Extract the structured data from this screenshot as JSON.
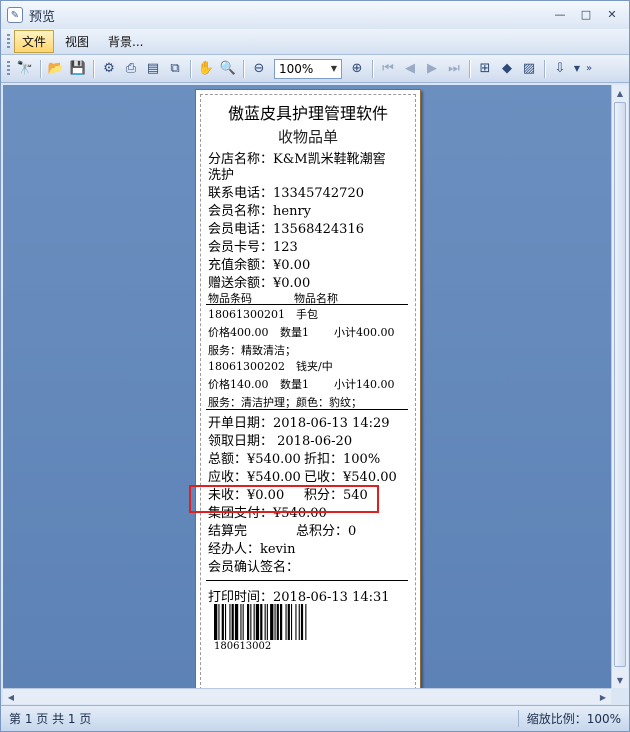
{
  "window": {
    "title": "预览",
    "controls": [
      "—",
      "□",
      "✕"
    ]
  },
  "menu": {
    "items": [
      "文件",
      "视图",
      "背景..."
    ]
  },
  "toolbar": {
    "zoom_value": "100%"
  },
  "status": {
    "pages": "第 1 页 共 1 页",
    "zoom": "缩放比例：100%"
  },
  "receipt": {
    "title": "傲蓝皮具护理管理软件",
    "subtitle": "收物品单",
    "store_line1": "分店名称：K&M凯米鞋靴潮窖",
    "store_line2": "洗护",
    "phone": "联系电话：13345742720",
    "member_name": "会员名称：henry",
    "member_phone": "会员电话：13568424316",
    "card_no": "会员卡号：123",
    "recharge_balance": "充值余额：¥0.00",
    "gift_balance": "赠送余额：¥0.00",
    "col_code": "物品条码",
    "col_name": "物品名称",
    "items": [
      {
        "code": "18061300201",
        "name": "手包",
        "price": "价格400.00",
        "qty": "数量1",
        "subtotal": "小计400.00",
        "service": "服务：精致清洁；"
      },
      {
        "code": "18061300202",
        "name": "钱夹/中",
        "price": "价格140.00",
        "qty": "数量1",
        "subtotal": "小计140.00",
        "service": "服务：清洁护理；颜色：豹纹；"
      }
    ],
    "open_date": "开单日期：2018-06-13 14:29",
    "pickup_date": "领取日期：  2018-06-20",
    "total": "总额：¥540.00",
    "discount": "折扣：100%",
    "receivable": "应收：¥540.00",
    "received": "已收：¥540.00",
    "unpaid": "未收：¥0.00",
    "points": "积分：540",
    "group_pay": "集团支付：¥540.00",
    "settled": "结算完",
    "total_points": "总积分：0",
    "operator": "经办人：kevin",
    "confirm_sign": "会员确认签名：",
    "print_time": "打印时间：2018-06-13 14:31",
    "barcode_number": "180613002"
  }
}
